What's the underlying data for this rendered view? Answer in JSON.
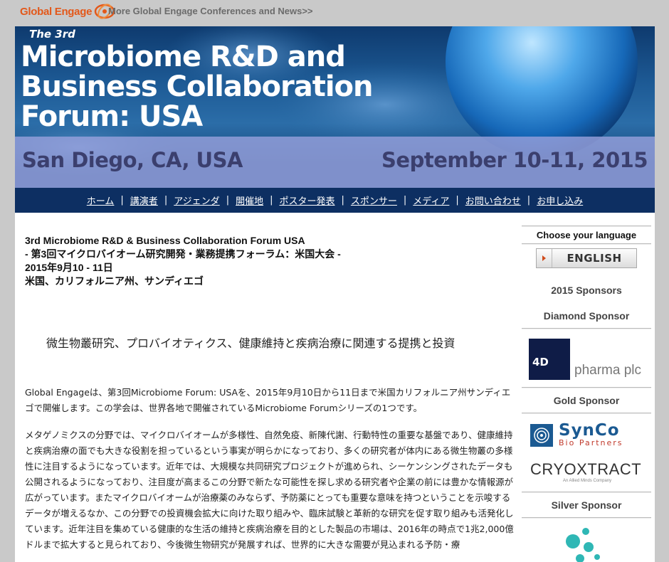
{
  "topbar": {
    "logo_text": "Global Engage",
    "more_link": "More Global Engage Conferences and News>>"
  },
  "banner": {
    "edition": "The 3rd",
    "title_line1": "Microbiome R&D and",
    "title_line2": "Business Collaboration",
    "title_line3": "Forum: USA",
    "location": "San Diego, CA, USA",
    "dates": "September 10-11, 2015"
  },
  "nav": {
    "items": [
      "ホーム",
      "講演者",
      "アジェンダ",
      "開催地",
      "ポスター発表",
      "スポンサー",
      "メディア",
      "お問い合わせ",
      "お申し込み"
    ],
    "separator": "|"
  },
  "main": {
    "heading_en": "3rd Microbiome R&D & Business Collaboration Forum USA",
    "heading_jp": "- 第3回マイクロバイオーム研究開発・業務提携フォーラム：米国大会 -",
    "heading_date": "2015年9月10 - 11日",
    "heading_place": "米国、カリフォルニア州、サンディエゴ",
    "tagline": "微生物叢研究、プロバイオティクス、健康維持と疾病治療に関連する提携と投資",
    "para1": "Global Engageは、第3回Microbiome Forum: USAを、2015年9月10日から11日まで米国カリフォルニア州サンディエゴで開催します。この学会は、世界各地で開催されているMicrobiome Forumシリーズの1つです。",
    "para2": "メタゲノミクスの分野では、マイクロバイオームが多様性、自然免疫、新陳代謝、行動特性の重要な基盤であり、健康維持と疾病治療の面でも大きな役割を担っているという事実が明らかになっており、多くの研究者が体内にある微生物叢の多様性に注目するようになっています。近年では、大規模な共同研究プロジェクトが進められ、シーケンシングされたデータも公開されるようになっており、注目度が高まるこの分野で新たな可能性を探し求める研究者や企業の前には豊かな情報源が広がっています。またマイクロバイオームが治療薬のみならず、予防薬にとっても重要な意味を持つということを示唆するデータが増えるなか、この分野での投資機会拡大に向けた取り組みや、臨床試験と革新的な研究を促す取り組みも活発化しています。近年注目を集めている健康的な生活の維持と疾病治療を目的とした製品の市場は、2016年の時点で1兆2,000億ドルまで拡大すると見られており、今後微生物研究が発展すれば、世界的に大きな需要が見込まれる予防・療"
  },
  "sidebar": {
    "choose_language": "Choose your language",
    "language_button": "ENGLISH",
    "sponsors_heading": "2015 Sponsors",
    "diamond_heading": "Diamond Sponsor",
    "gold_heading": "Gold Sponsor",
    "silver_heading": "Silver Sponsor",
    "sponsor_4d_mark": "4D",
    "sponsor_4d_text": "pharma plc",
    "sponsor_synco_name": "SynCo",
    "sponsor_synco_sub": "Bio Partners",
    "sponsor_cryo_name": "CRYOXTRACT",
    "sponsor_cryo_sub": "An Allied Minds Company"
  },
  "colors": {
    "nav_bg": "#0d2f62",
    "logo_orange": "#e3581a",
    "band": "#96a0dc",
    "synco_blue": "#1b5a92",
    "silver_teal": "#2fb7b5"
  }
}
